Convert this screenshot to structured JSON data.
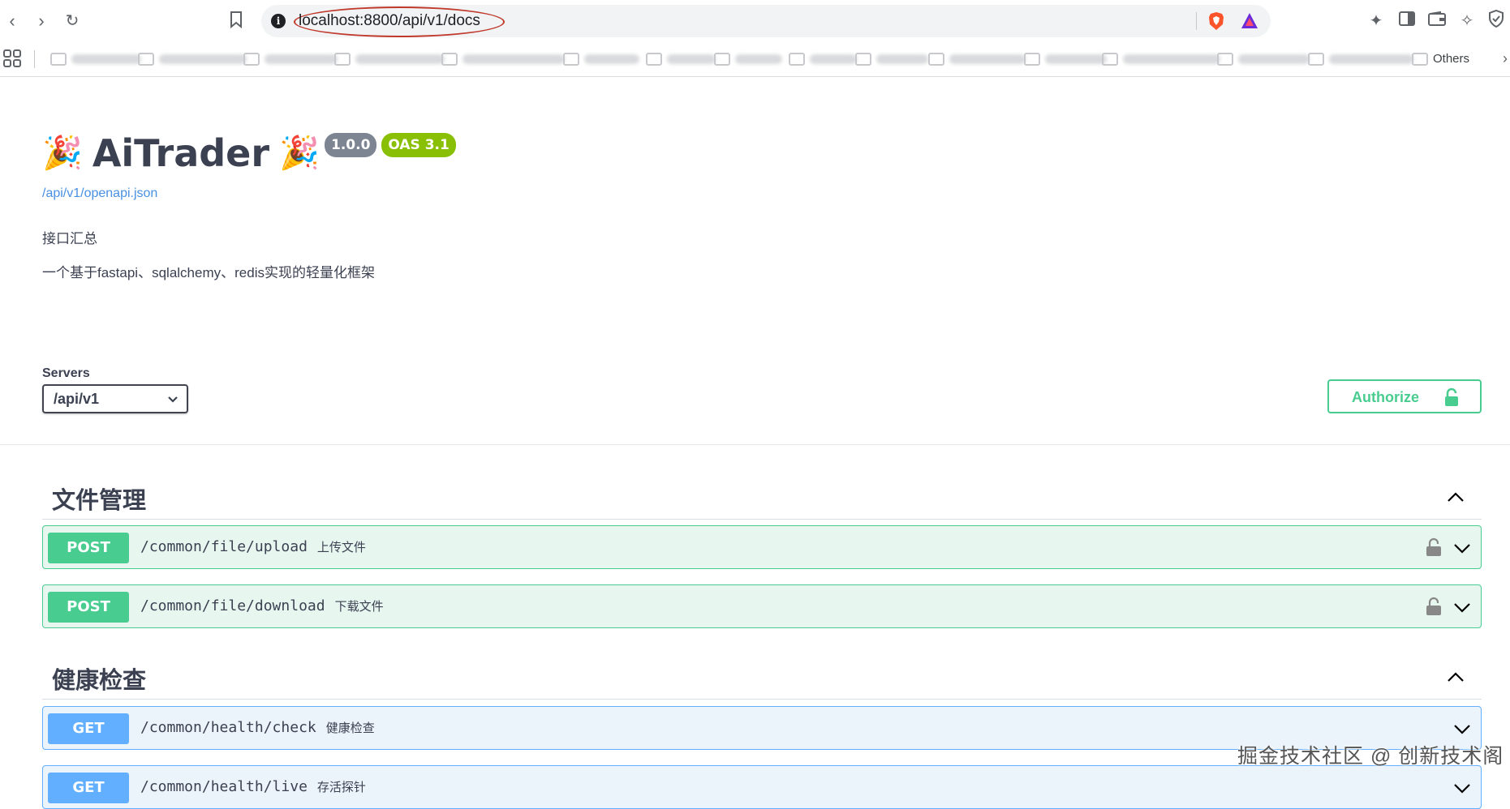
{
  "browser": {
    "url": "localhost:8800/api/v1/docs",
    "bookmarks_other_label": "Others"
  },
  "info": {
    "title_emoji": "🎉",
    "title": "AiTrader",
    "version": "1.0.0",
    "oas": "OAS 3.1",
    "spec_link": "/api/v1/openapi.json",
    "summary": "接口汇总",
    "description": "一个基于fastapi、sqlalchemy、redis实现的轻量化框架"
  },
  "servers": {
    "label": "Servers",
    "selected": "/api/v1"
  },
  "authorize_label": "Authorize",
  "tags": [
    {
      "name": "文件管理",
      "operations": [
        {
          "method": "POST",
          "path": "/common/file/upload",
          "summary": "上传文件"
        },
        {
          "method": "POST",
          "path": "/common/file/download",
          "summary": "下载文件"
        }
      ]
    },
    {
      "name": "健康检查",
      "operations": [
        {
          "method": "GET",
          "path": "/common/health/check",
          "summary": "健康检查"
        },
        {
          "method": "GET",
          "path": "/common/health/live",
          "summary": "存活探针"
        }
      ]
    }
  ],
  "watermark": "掘金技术社区 @ 创新技术阁",
  "colors": {
    "post": "#49cc90",
    "get": "#61affe",
    "badge_version": "#7d8492",
    "badge_oas": "#89bf04",
    "url_highlight": "#c0392b"
  }
}
